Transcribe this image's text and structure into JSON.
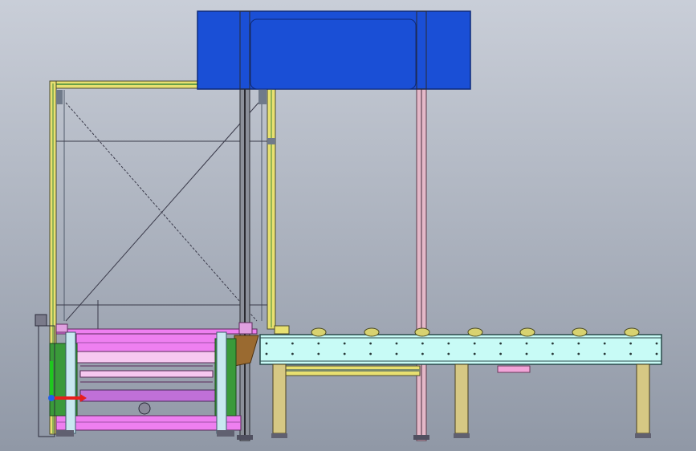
{
  "viewport": {
    "background_top": "#c9ced8",
    "background_bottom": "#9098a6"
  },
  "colors": {
    "housing_blue": "#1a4fd6",
    "frame_yellow": "#e8e070",
    "frame_green": "#3e8a3a",
    "conveyor_cyan": "#c8fbf6",
    "roller_yellow": "#d8d270",
    "leg_tan": "#d6c884",
    "machine_magenta": "#ee7ff0",
    "machine_pink": "#f6c8f0",
    "machine_green": "#3a9a3a",
    "machine_purple": "#c070d8",
    "cable_dark": "#3a3a4a",
    "tag_pink": "#f2a4d8",
    "bracket_brown": "#9a6a30",
    "triad_y_green": "#1ec81e",
    "triad_x_red": "#e81e1e",
    "triad_origin_blue": "#2060e8"
  },
  "icons": {
    "triad": "coordinate-triad-icon"
  }
}
